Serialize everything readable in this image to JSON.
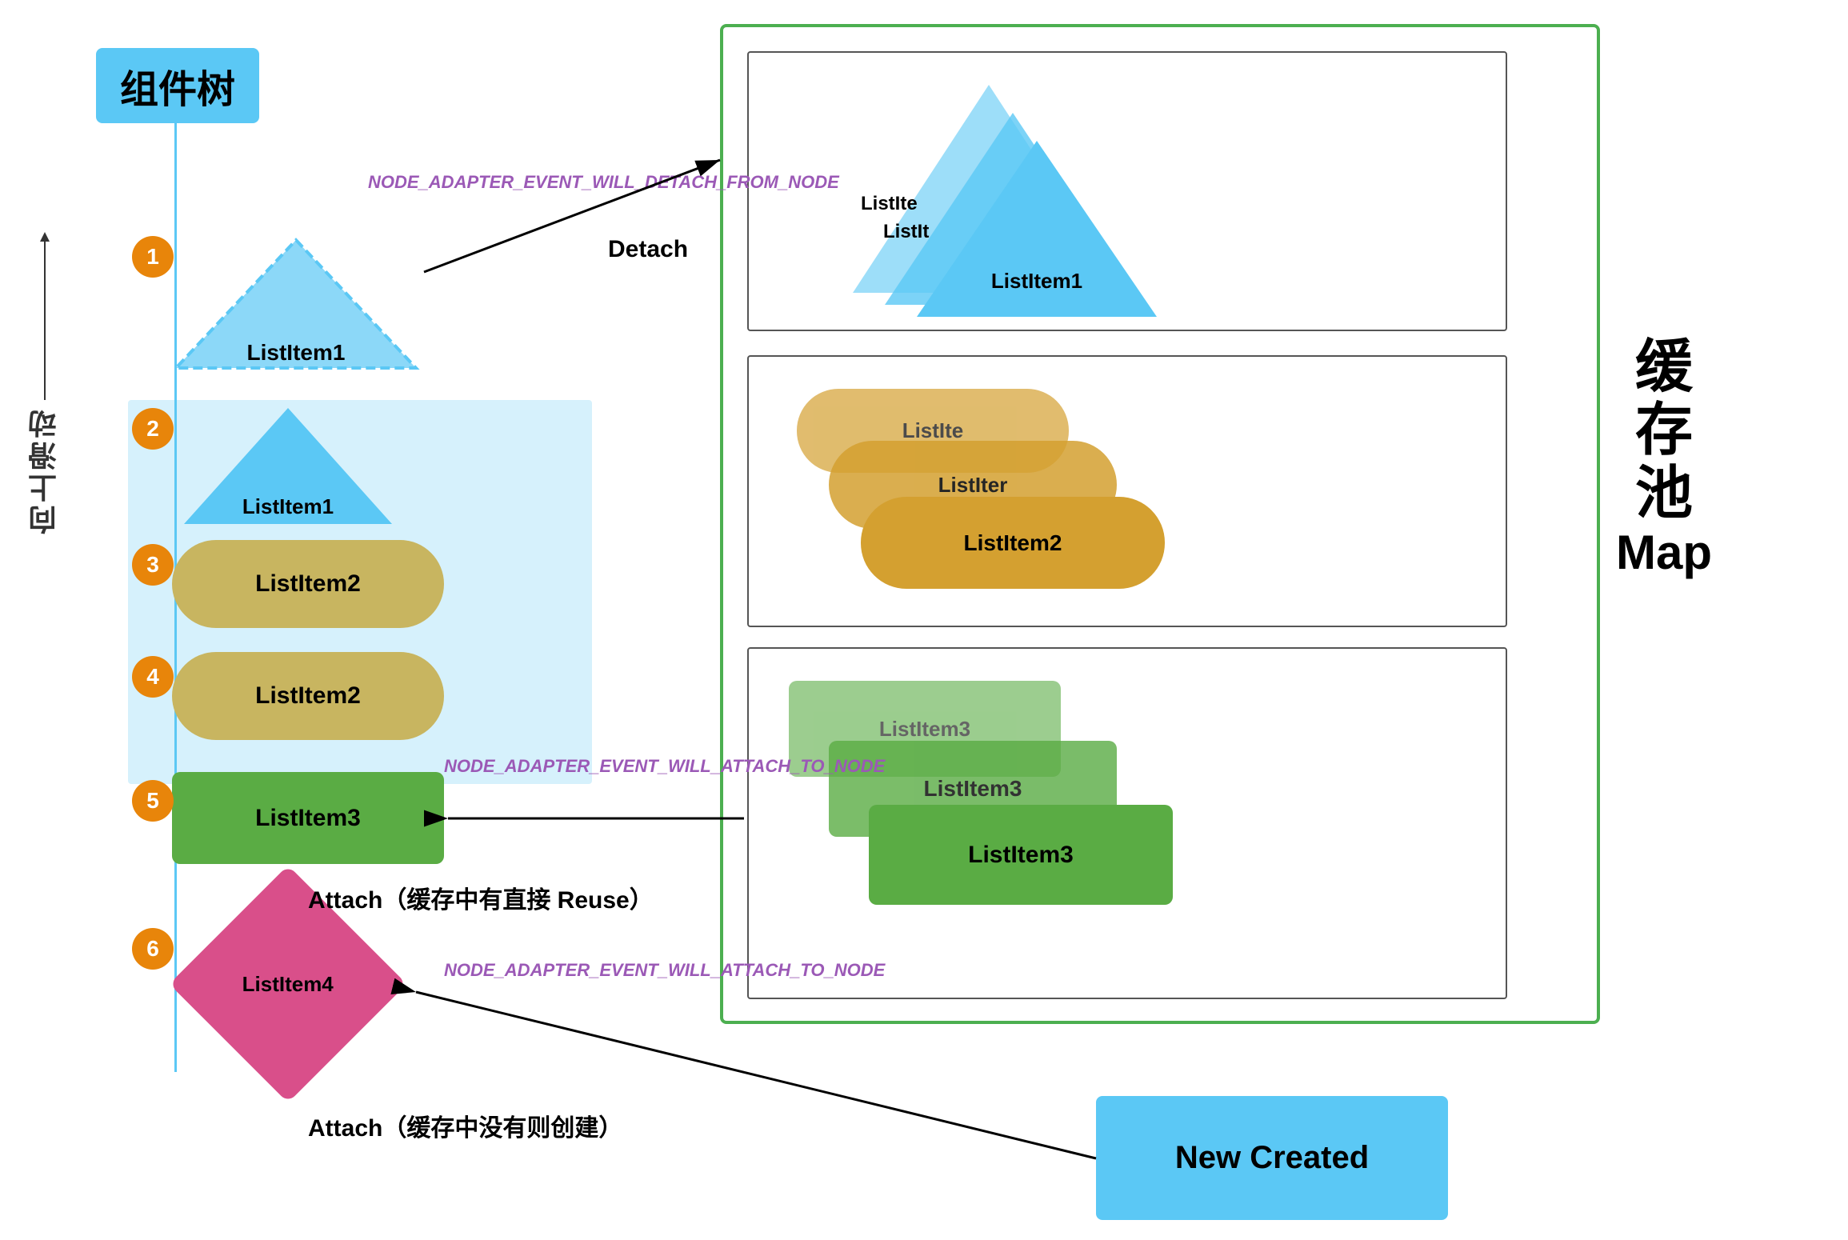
{
  "title": "组件树",
  "vertical_label": "向上滑动",
  "cache_pool_label": "缓存\n池\nMap",
  "new_created_label": "New Created",
  "items": [
    {
      "badge": "1",
      "label": "ListItem1",
      "type": "triangle-dashed"
    },
    {
      "badge": "2",
      "label": "ListItem1",
      "type": "triangle"
    },
    {
      "badge": "3",
      "label": "ListItem2",
      "type": "oval"
    },
    {
      "badge": "4",
      "label": "ListItem2",
      "type": "oval"
    },
    {
      "badge": "5",
      "label": "ListItem3",
      "type": "green-rect"
    },
    {
      "badge": "6",
      "label": "ListItem4",
      "type": "diamond"
    }
  ],
  "events": {
    "detach_event": "NODE_ADAPTER_EVENT_WILL_DETACH_FROM_NODE",
    "detach_label": "Detach",
    "attach_event1": "NODE_ADAPTER_EVENT_WILL_ATTACH_TO_NODE",
    "attach_label1": "Attach（缓存中有直接 Reuse）",
    "attach_event2": "NODE_ADAPTER_EVENT_WILL_ATTACH_TO_NODE",
    "attach_label2": "Attach（缓存中没有则创建）"
  },
  "cache_subboxes": {
    "box1_label": "ListItem1",
    "box2_label": "ListItem2",
    "box3_label": "ListItem3"
  }
}
